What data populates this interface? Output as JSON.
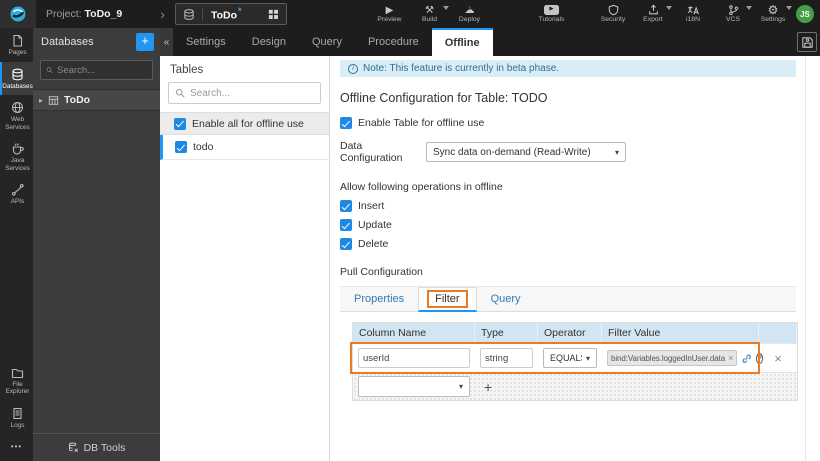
{
  "topbar": {
    "project_prefix": "Project:",
    "project_name": "ToDo_9",
    "app_name": "ToDo",
    "modified_marker": "*",
    "actions": {
      "preview": "Preview",
      "build": "Build",
      "deploy": "Deploy",
      "tutorials": "Tutorials",
      "security": "Security",
      "export": "Export",
      "i18n": "i18N",
      "vcs": "VCS",
      "settings": "Settings"
    },
    "avatar": "JS"
  },
  "sidebar": {
    "pages": "Pages",
    "databases": "Databases",
    "web_services": "Web Services",
    "java_services": "Java Services",
    "apis": "APIs",
    "file_explorer": "File Explorer",
    "logs": "Logs",
    "more": "•••"
  },
  "db_panel": {
    "title": "Databases",
    "add": "+",
    "search_placeholder": "Search...",
    "item": "ToDo",
    "db_tools": "DB Tools"
  },
  "editor_tabs": {
    "collapse": "«",
    "settings": "Settings",
    "design": "Design",
    "query": "Query",
    "procedure": "Procedure",
    "offline": "Offline"
  },
  "tables_panel": {
    "title": "Tables",
    "search_placeholder": "Search...",
    "enable_all": "Enable all for offline use",
    "table1": "todo"
  },
  "main": {
    "note": "Note: This feature is currently in beta phase.",
    "title": "Offline Configuration for Table: TODO",
    "enable_table": "Enable Table for offline use",
    "data_config_label": "Data Configuration",
    "data_config_value": "Sync data on-demand (Read-Write)",
    "operations_label": "Allow following operations in offline",
    "op_insert": "Insert",
    "op_update": "Update",
    "op_delete": "Delete",
    "pull_label": "Pull Configuration",
    "tab_properties": "Properties",
    "tab_filter": "Filter",
    "tab_query": "Query",
    "filter_table": {
      "h_column": "Column Name",
      "h_type": "Type",
      "h_operator": "Operator",
      "h_filter": "Filter Value",
      "row": {
        "column": "userId",
        "type": "string",
        "operator": "EQUALS",
        "value": "bind:Variables.loggedInUser.data"
      }
    }
  },
  "glyphs": {
    "chevron": "›",
    "caret_right": "▸",
    "dropdown": "▾",
    "close": "×",
    "plus": "+",
    "play": "▶",
    "build": "⚒",
    "cloud": "☁",
    "up_arrow": "↑",
    "gear": "⚙",
    "help": "?",
    "info": "i"
  },
  "colors": {
    "accent": "#2196f3",
    "annotation": "#ec7a23",
    "link": "#337ab7",
    "note_bg": "#d9edf7",
    "note_text": "#31708f",
    "avatar_bg": "#43a047"
  }
}
